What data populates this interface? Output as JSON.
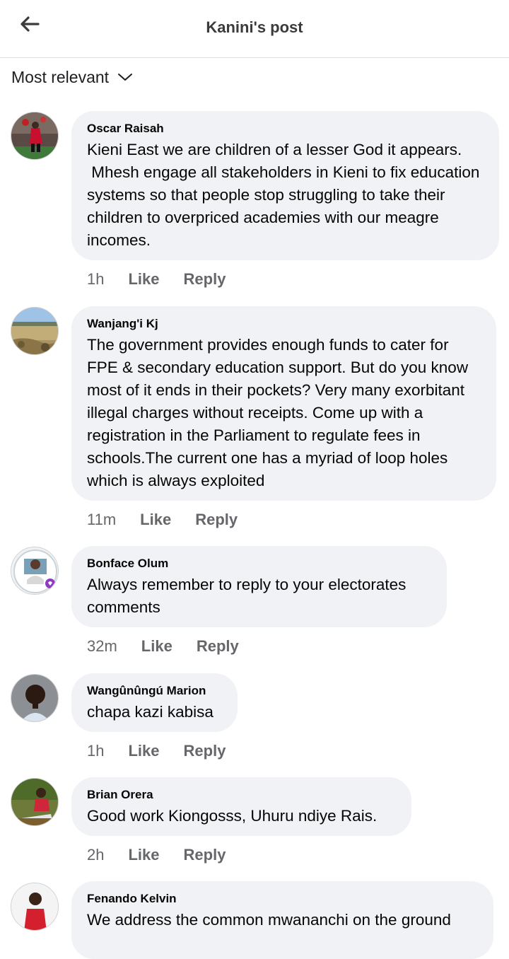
{
  "header": {
    "title": "Kanini's post"
  },
  "sort": {
    "label": "Most relevant"
  },
  "comments": [
    {
      "author": "Oscar Raisah",
      "text": "Kieni East we are children of a lesser God it appears.\n Mhesh engage all stakeholders in Kieni to fix education systems so that people stop struggling to take their children to overpriced academies with our meagre incomes.",
      "time": "1h",
      "like": "Like",
      "reply": "Reply"
    },
    {
      "author": "Wanjang'i Kj",
      "text": "The government provides enough funds to cater for FPE & secondary education support. But do you know most of it ends in their pockets? Very many exorbitant illegal charges without receipts. Come up with a registration in the Parliament to regulate fees in schools.The current one has a myriad of loop holes which is always exploited",
      "time": "11m",
      "like": "Like",
      "reply": "Reply"
    },
    {
      "author": "Bonface Olum",
      "text": "Always remember to reply to your electorates comments",
      "time": "32m",
      "like": "Like",
      "reply": "Reply"
    },
    {
      "author": "Wangûnûngú Marion",
      "text": "chapa kazi kabisa",
      "time": "1h",
      "like": "Like",
      "reply": "Reply"
    },
    {
      "author": "Brian Orera",
      "text": "Good work Kiongosss, Uhuru ndiye Rais.",
      "time": "2h",
      "like": "Like",
      "reply": "Reply"
    },
    {
      "author": "Fenando Kelvin",
      "text": "We address the common mwananchi on the ground"
    }
  ],
  "icons": {
    "back": "arrow-left-icon",
    "sort": "chevron-down-icon"
  },
  "colors": {
    "bubble": "#f0f2f5",
    "secondary_text": "#65676b",
    "title": "#3a3b3c"
  }
}
